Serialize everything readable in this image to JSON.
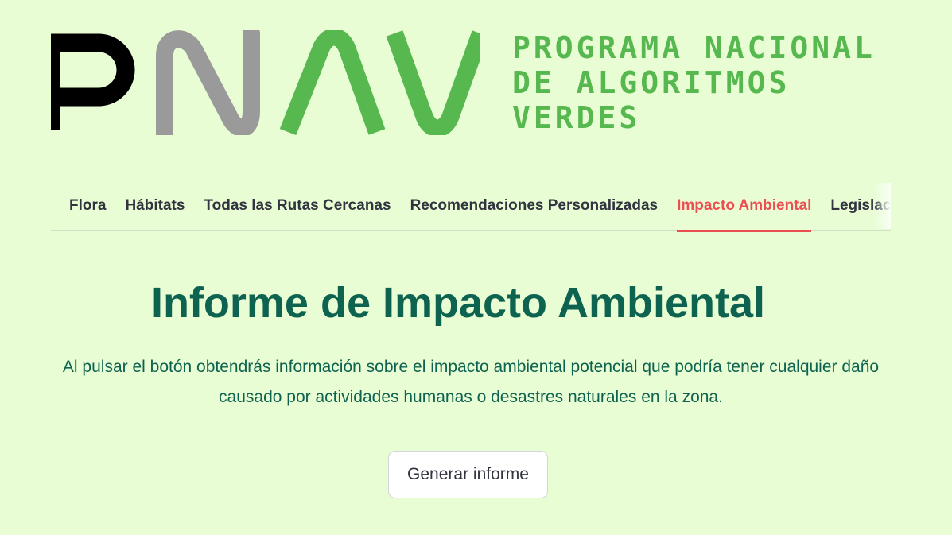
{
  "logo": {
    "mark_text": "PNAV",
    "text_lines": [
      "PROGRAMA NACIONAL",
      "DE ALGORITMOS",
      "VERDES"
    ],
    "colors": {
      "black": "#000000",
      "gray": "#9a9a9a",
      "green": "#56b84f"
    }
  },
  "tabs": [
    {
      "label": "Flora",
      "active": false
    },
    {
      "label": "Hábitats",
      "active": false
    },
    {
      "label": "Todas las Rutas Cercanas",
      "active": false
    },
    {
      "label": "Recomendaciones Personalizadas",
      "active": false
    },
    {
      "label": "Impacto Ambiental",
      "active": true
    },
    {
      "label": "Legislación",
      "active": false
    }
  ],
  "main": {
    "title": "Informe de Impacto Ambiental",
    "description": "Al pulsar el botón obtendrás información sobre el impacto ambiental potencial que podría tener cualquier daño causado por actividades humanas o desastres naturales en la zona.",
    "button_label": "Generar informe"
  },
  "colors": {
    "background": "#e8fdd4",
    "accent_active_tab": "#ec4f52",
    "title": "#0e6350",
    "tab_text": "#31333f"
  }
}
